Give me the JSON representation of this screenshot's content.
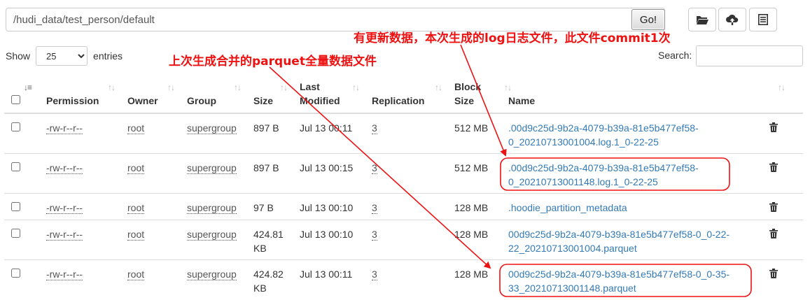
{
  "path": {
    "value": "/hudi_data/test_person/default"
  },
  "go_label": "Go!",
  "icons": {
    "folder": "folder-open-icon",
    "upload": "cloud-upload-icon",
    "list": "list-icon"
  },
  "length": {
    "show": "Show",
    "value": "25",
    "entries": "entries"
  },
  "search": {
    "label": "Search:",
    "value": ""
  },
  "table": {
    "headers": {
      "permission": "Permission",
      "owner": "Owner",
      "group": "Group",
      "size": "Size",
      "last_modified_1": "Last",
      "last_modified_2": "Modified",
      "replication": "Replication",
      "block_size_1": "Block",
      "block_size_2": "Size",
      "name": "Name"
    },
    "rows": [
      {
        "perm": "-rw-r--r--",
        "owner": "root",
        "group": "supergroup",
        "size1": "897 B",
        "size2": "",
        "modified": "Jul 13 00:11",
        "repl": "3",
        "block": "512 MB",
        "name1": ".00d9c25d-9b2a-4079-b39a-81e5b477ef58-",
        "name2": "0_20210713001004.log.1_0-22-25"
      },
      {
        "perm": "-rw-r--r--",
        "owner": "root",
        "group": "supergroup",
        "size1": "897 B",
        "size2": "",
        "modified": "Jul 13 00:15",
        "repl": "3",
        "block": "512 MB",
        "name1": ".00d9c25d-9b2a-4079-b39a-81e5b477ef58-",
        "name2": "0_20210713001148.log.1_0-22-25"
      },
      {
        "perm": "-rw-r--r--",
        "owner": "root",
        "group": "supergroup",
        "size1": "97 B",
        "size2": "",
        "modified": "Jul 13 00:10",
        "repl": "3",
        "block": "128 MB",
        "name1": ".hoodie_partition_metadata",
        "name2": ""
      },
      {
        "perm": "-rw-r--r--",
        "owner": "root",
        "group": "supergroup",
        "size1": "424.81",
        "size2": "KB",
        "modified": "Jul 13 00:10",
        "repl": "3",
        "block": "128 MB",
        "name1": "00d9c25d-9b2a-4079-b39a-81e5b477ef58-0_0-22-",
        "name2": "22_20210713001004.parquet"
      },
      {
        "perm": "-rw-r--r--",
        "owner": "root",
        "group": "supergroup",
        "size1": "424.82",
        "size2": "KB",
        "modified": "Jul 13 00:11",
        "repl": "3",
        "block": "128 MB",
        "name1": "00d9c25d-9b2a-4079-b39a-81e5b477ef58-0_0-35-",
        "name2": "33_20210713001148.parquet"
      }
    ]
  },
  "annotations": {
    "log_note": "有更新数据，本次生成的log日志文件，此文件commit1次",
    "parquet_note": "上次生成合并的parquet全量数据文件"
  },
  "colors": {
    "annotation": "#ee1111",
    "link": "#337ab7"
  }
}
